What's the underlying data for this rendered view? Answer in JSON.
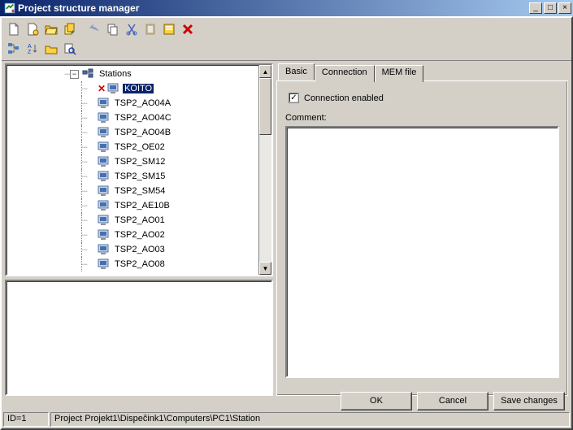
{
  "window": {
    "title": "Project structure manager"
  },
  "tree": {
    "root_label": "Stations",
    "selected_index": 0,
    "items": [
      {
        "label": "KOITO",
        "disabled": true
      },
      {
        "label": "TSP2_AO04A"
      },
      {
        "label": "TSP2_AO04C"
      },
      {
        "label": "TSP2_AO04B"
      },
      {
        "label": "TSP2_OE02"
      },
      {
        "label": "TSP2_SM12"
      },
      {
        "label": "TSP2_SM15"
      },
      {
        "label": "TSP2_SM54"
      },
      {
        "label": "TSP2_AE10B"
      },
      {
        "label": "TSP2_AO01"
      },
      {
        "label": "TSP2_AO02"
      },
      {
        "label": "TSP2_AO03"
      },
      {
        "label": "TSP2_AO08"
      }
    ]
  },
  "tabs": {
    "items": [
      "Basic",
      "Connection",
      "MEM file"
    ],
    "active": 0
  },
  "basic_tab": {
    "connection_enabled_label": "Connection enabled",
    "connection_enabled_checked": true,
    "comment_label": "Comment:",
    "comment_value": ""
  },
  "buttons": {
    "ok": "OK",
    "cancel": "Cancel",
    "save": "Save changes"
  },
  "status": {
    "id": "ID=1",
    "path": "Project Projekt1\\Dispečink1\\Computers\\PC1\\Station"
  }
}
